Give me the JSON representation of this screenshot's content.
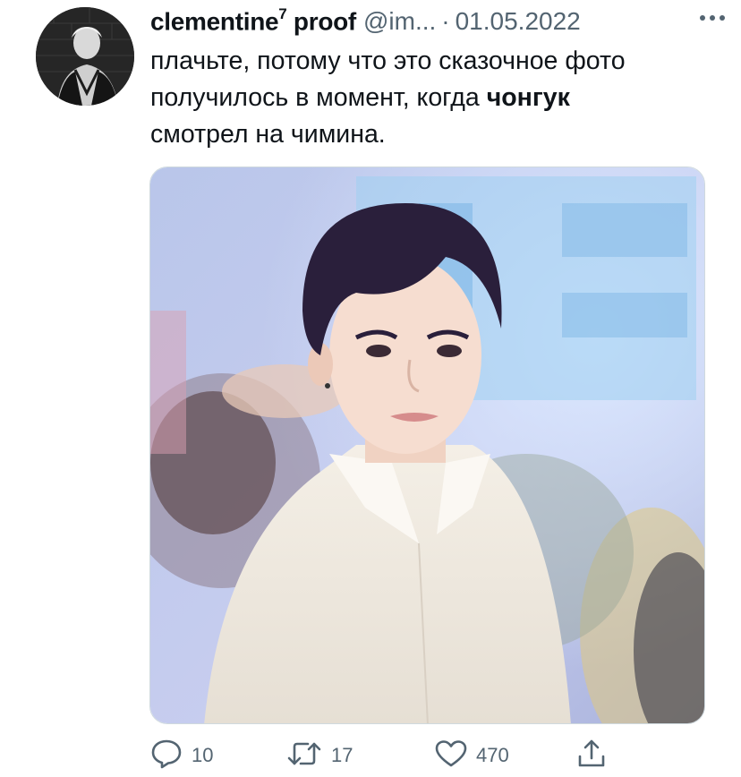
{
  "tweet": {
    "author": {
      "display_name": "clementine",
      "name_superscript": "7",
      "display_name_suffix": "proof",
      "handle": "@im...",
      "avatar_icon": "user-avatar-icon"
    },
    "separator": "·",
    "date": "01.05.2022",
    "more_icon": "more-horizontal-icon",
    "text": {
      "line1": "плачьте, потому что это сказочное фото",
      "line2_before": "получилось в момент, когда",
      "line2_bold": "чонгук",
      "line3": "смотрел на чимина."
    },
    "media": {
      "kind": "photo"
    },
    "actions": {
      "reply_count": "10",
      "retweet_count": "17",
      "like_count": "470",
      "reply_icon": "reply-icon",
      "retweet_icon": "retweet-icon",
      "like_icon": "heart-icon",
      "share_icon": "share-icon"
    }
  },
  "colors": {
    "text_primary": "#0f1419",
    "text_secondary": "#536471",
    "border": "#cfd9de"
  }
}
